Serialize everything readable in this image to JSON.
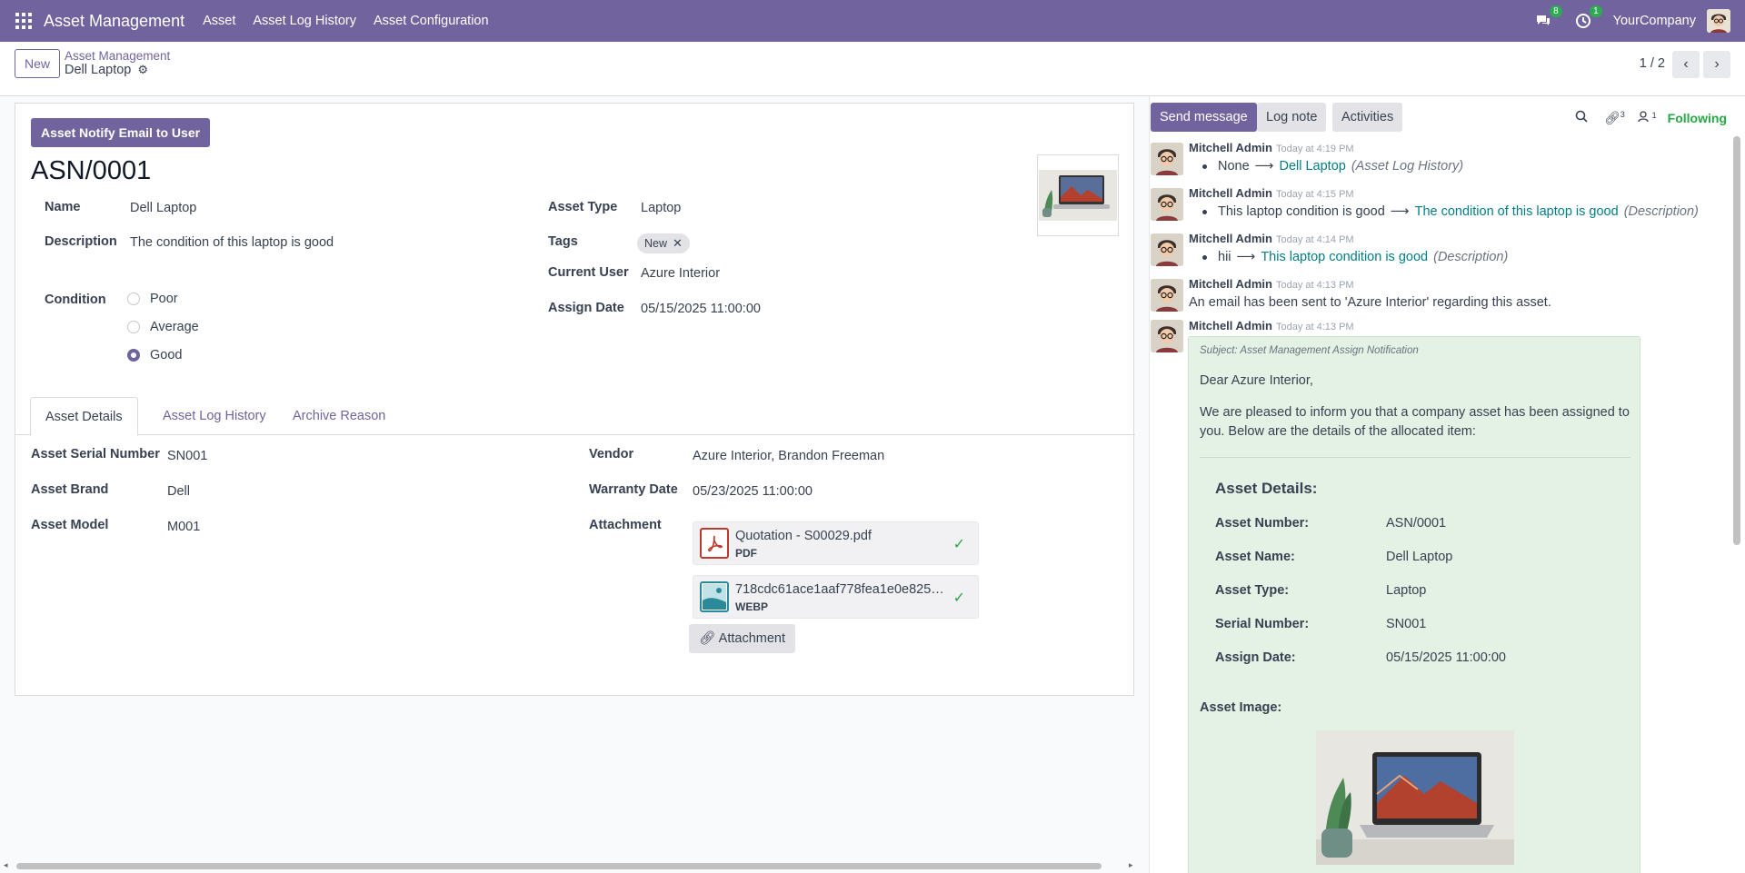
{
  "navbar": {
    "app_name": "Asset Management",
    "menu": [
      "Asset",
      "Asset Log History",
      "Asset Configuration"
    ],
    "messages_count": "8",
    "activities_count": "1",
    "company": "YourCompany",
    "color": "#71639e"
  },
  "control": {
    "new_label": "New",
    "breadcrumb_parent": "Asset Management",
    "breadcrumb_current": "Dell Laptop",
    "pager": "1 / 2"
  },
  "form": {
    "notify_button": "Asset Notify Email to User",
    "title": "ASN/0001",
    "name_label": "Name",
    "name_value": "Dell Laptop",
    "description_label": "Description",
    "description_value": "The condition of this laptop is good",
    "condition_label": "Condition",
    "condition_options": [
      "Poor",
      "Average",
      "Good"
    ],
    "condition_selected": "Good",
    "asset_type_label": "Asset Type",
    "asset_type_value": "Laptop",
    "tags_label": "Tags",
    "tag_value": "New",
    "current_user_label": "Current User",
    "current_user_value": "Azure Interior",
    "assign_date_label": "Assign Date",
    "assign_date_value": "05/15/2025 11:00:00"
  },
  "tabs": [
    "Asset Details",
    "Asset Log History",
    "Archive Reason"
  ],
  "details": {
    "serial_label": "Asset Serial Number",
    "serial_value": "SN001",
    "brand_label": "Asset Brand",
    "brand_value": "Dell",
    "model_label": "Asset Model",
    "model_value": "M001",
    "vendor_label": "Vendor",
    "vendor_value": "Azure Interior, Brandon Freeman",
    "warranty_label": "Warranty Date",
    "warranty_value": "05/23/2025 11:00:00",
    "attachment_label": "Attachment",
    "attachments": [
      {
        "name": "Quotation - S00029.pdf",
        "type": "PDF"
      },
      {
        "name": "718cdc61ace1aaf778fea1e0e8254...",
        "type": "WEBP"
      }
    ],
    "attach_button": "Attachment"
  },
  "chatter": {
    "send_message": "Send message",
    "log_note": "Log note",
    "activities": "Activities",
    "attachments_count": "3",
    "followers_count": "1",
    "following": "Following",
    "messages": [
      {
        "author": "Mitchell Admin",
        "date": "Today at 4:19 PM",
        "old": "None",
        "new": "Dell Laptop",
        "field": "(Asset Log History)"
      },
      {
        "author": "Mitchell Admin",
        "date": "Today at 4:15 PM",
        "old": "This laptop condition is good",
        "new": "The condition of this laptop is good",
        "field": "(Description)"
      },
      {
        "author": "Mitchell Admin",
        "date": "Today at 4:14 PM",
        "old": "hii",
        "new": "This laptop condition is good",
        "field": "(Description)"
      },
      {
        "author": "Mitchell Admin",
        "date": "Today at 4:13 PM",
        "text": "An email has been sent to 'Azure Interior' regarding this asset."
      },
      {
        "author": "Mitchell Admin",
        "date": "Today at 4:13 PM"
      }
    ],
    "mail": {
      "subject": "Subject: Asset Management Assign Notification",
      "greeting": "Dear Azure Interior,",
      "intro_1": "We are pleased to inform you that a company asset has been assigned to",
      "intro_2": "you. Below are the details of the allocated item:",
      "details_title": "Asset Details:",
      "rows": [
        {
          "label": "Asset Number:",
          "value": "ASN/0001"
        },
        {
          "label": "Asset Name:",
          "value": "Dell Laptop"
        },
        {
          "label": "Asset Type:",
          "value": "Laptop"
        },
        {
          "label": "Serial Number:",
          "value": "SN001"
        },
        {
          "label": "Assign Date:",
          "value": "05/15/2025 11:00:00"
        }
      ],
      "image_label": "Asset Image:"
    }
  }
}
